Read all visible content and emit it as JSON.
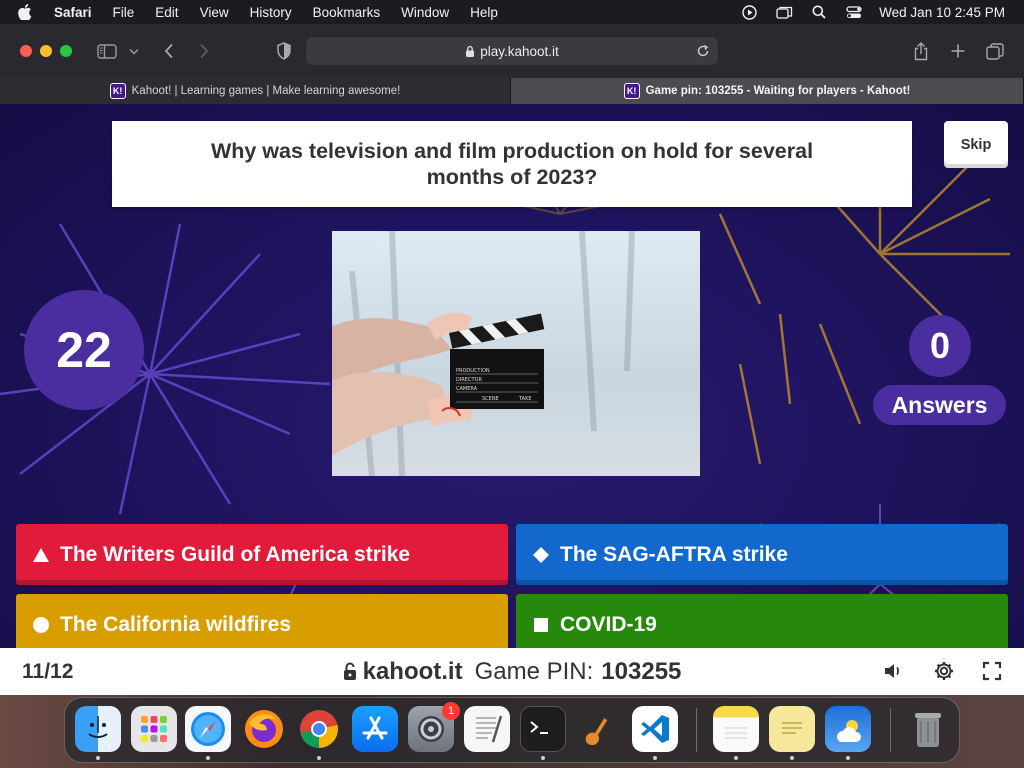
{
  "menubar": {
    "app_name": "Safari",
    "items": [
      "File",
      "Edit",
      "View",
      "History",
      "Bookmarks",
      "Window",
      "Help"
    ],
    "clock": "Wed Jan 10  2:45 PM"
  },
  "browser": {
    "url": "play.kahoot.it",
    "tabs": [
      {
        "title": "Kahoot! | Learning games | Make learning awesome!",
        "favicon": "K!",
        "active": false
      },
      {
        "title": "Game pin: 103255 - Waiting for players - Kahoot!",
        "favicon": "K!",
        "active": true
      }
    ]
  },
  "game": {
    "question": "Why was television and film production on hold for several months of 2023?",
    "skip_label": "Skip",
    "timer": "22",
    "answer_count": "0",
    "answers_label": "Answers",
    "answers": [
      {
        "text": "The Writers Guild of America strike",
        "shape": "triangle",
        "color": "#e21b3c"
      },
      {
        "text": "The SAG-AFTRA strike",
        "shape": "diamond",
        "color": "#1368ce"
      },
      {
        "text": "The California wildfires",
        "shape": "circle",
        "color": "#d89e00"
      },
      {
        "text": "COVID-19",
        "shape": "square",
        "color": "#26890c"
      }
    ],
    "image_clapper": {
      "line1": "PRODUCTION",
      "line2": "DIRECTOR",
      "line3": "CAMERA",
      "line4": "SCENE",
      "line5": "TAKE"
    },
    "bottom": {
      "progress": "11/12",
      "site": "kahoot.it",
      "pin_label": "Game PIN:",
      "pin": "103255"
    }
  },
  "dock": {
    "apps": [
      "finder-icon",
      "launchpad-icon",
      "safari-icon",
      "firefox-icon",
      "chrome-icon",
      "app-store-icon",
      "system-settings-icon",
      "textedit-icon",
      "terminal-icon",
      "garageband-icon",
      "vscode-icon",
      "notes-icon",
      "stickies-icon",
      "weather-icon",
      "trash-icon"
    ],
    "settings_badge": "1"
  },
  "colors": {
    "kahoot_purple": "#46178f",
    "answer_red": "#e21b3c",
    "answer_blue": "#1368ce",
    "answer_yellow": "#d89e00",
    "answer_green": "#26890c"
  }
}
